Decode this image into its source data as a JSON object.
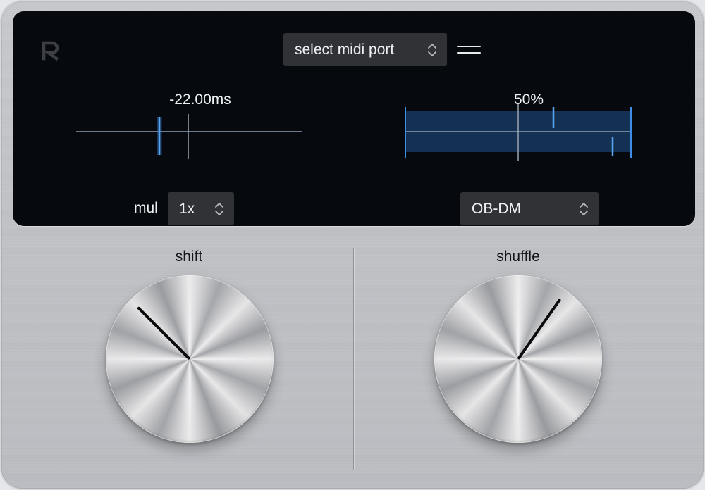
{
  "header": {
    "logo_icon": "r-logo-icon",
    "midi_port_label": "select midi port",
    "menu_icon": "menu-icon"
  },
  "shift": {
    "value_label": "-22.00ms",
    "label": "shift",
    "mul_label": "mul",
    "mul_value": "1x",
    "knob_angle_deg": -45
  },
  "shuffle": {
    "value_label": "50%",
    "label": "shuffle",
    "model_value": "OB-DM",
    "knob_angle_deg": 35
  },
  "colors": {
    "screen_bg": "#060a0f",
    "accent_blue": "#3d8ee8",
    "shaded_region": "#16345a",
    "select_bg": "#303236",
    "panel_bg": "#c2c4c8"
  }
}
